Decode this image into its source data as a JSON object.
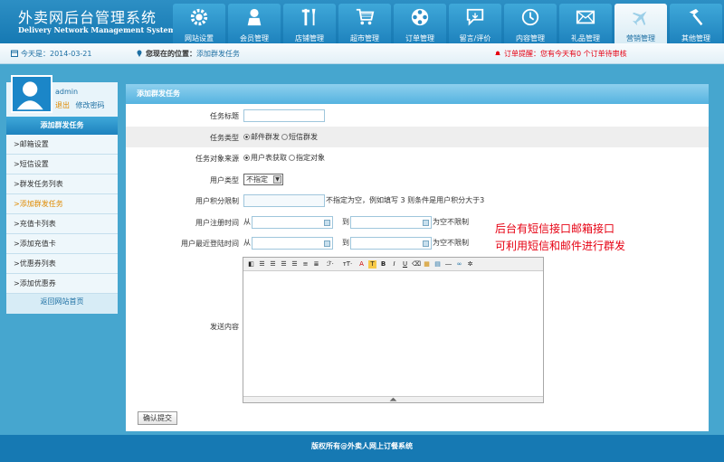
{
  "app": {
    "title_cn": "外卖网后台管理系统",
    "title_en": "Delivery Network Management System"
  },
  "nav": {
    "items": [
      {
        "label": "网站设置",
        "icon": "gear-icon"
      },
      {
        "label": "会员管理",
        "icon": "user-icon"
      },
      {
        "label": "店铺管理",
        "icon": "tools-icon"
      },
      {
        "label": "超市管理",
        "icon": "cart-icon"
      },
      {
        "label": "订单管理",
        "icon": "film-reel-icon"
      },
      {
        "label": "留言/评价",
        "icon": "comment-icon"
      },
      {
        "label": "内容管理",
        "icon": "clock-icon"
      },
      {
        "label": "礼品管理",
        "icon": "mail-icon"
      },
      {
        "label": "营销管理",
        "icon": "airplane-icon"
      },
      {
        "label": "其他管理",
        "icon": "hammer-icon"
      }
    ],
    "active_index": 8
  },
  "topbar": {
    "date": "今天是：2014-03-21",
    "location_label": "您现在的位置：",
    "location_value": "添加群发任务",
    "reminder": "订单提醒：您有今天有0 个订单待审核"
  },
  "sidebar": {
    "username": "admin",
    "logout": "退出",
    "change_password": "修改密码",
    "section_title": "添加群发任务",
    "items": [
      {
        "label": ">邮箱设置"
      },
      {
        "label": ">短信设置"
      },
      {
        "label": ">群发任务列表"
      },
      {
        "label": ">添加群发任务"
      },
      {
        "label": ">充值卡列表"
      },
      {
        "label": ">添加充值卡"
      },
      {
        "label": ">优惠券列表"
      },
      {
        "label": ">添加优惠券"
      }
    ],
    "active_index": 3,
    "home_link": "返回网站首页"
  },
  "form": {
    "title": "添加群发任务",
    "task_title_label": "任务标题",
    "task_title_value": "",
    "task_type_label": "任务类型",
    "task_type_options": [
      "邮件群发",
      "短信群发"
    ],
    "task_type_selected": 0,
    "target_source_label": "任务对象来源",
    "target_source_options": [
      "用户表获取",
      "指定对象"
    ],
    "target_source_selected": 0,
    "user_type_label": "用户类型",
    "user_type_value": "不指定",
    "points_label": "用户积分限制",
    "points_hint": "不指定为空，例如填写 3 则条件是用户积分大于3",
    "reg_time_label": "用户注册时间",
    "last_login_label": "用户最近登陆时间",
    "from": "从",
    "to": "到",
    "no_limit": "为空不限制",
    "content_label": "发送内容",
    "submit": "确认提交"
  },
  "annotation": {
    "line1": "后台有短信接口邮箱接口",
    "line2": "可利用短信和邮件进行群发"
  },
  "footer": {
    "text": "版权所有@外卖人网上订餐系统"
  },
  "colors": {
    "header_blue": "#1679b3",
    "body_blue": "#46a6cf",
    "accent_orange": "#e08a00",
    "alert_red": "#e60012"
  }
}
